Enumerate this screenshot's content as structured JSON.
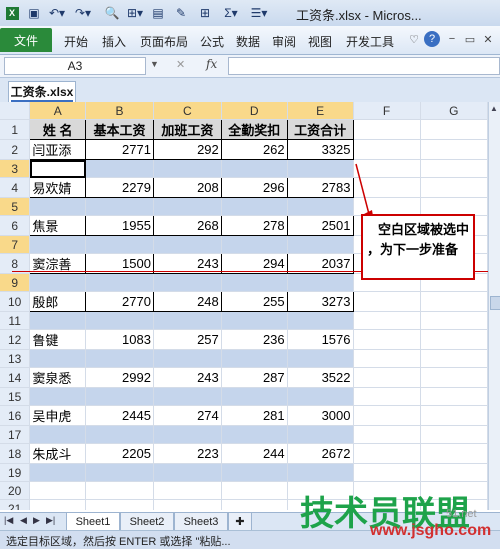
{
  "window": {
    "title": "工资条.xlsx - Micros..."
  },
  "qat": {
    "icons": [
      "save-icon",
      "undo-icon",
      "redo-icon",
      "print-preview-icon",
      "format-icon",
      "paste-icon",
      "format-painter-icon",
      "borders-icon",
      "autosum-icon",
      "align-icon"
    ]
  },
  "ribbon": {
    "file": "文件",
    "tabs": [
      "开始",
      "插入",
      "页面布局",
      "公式",
      "数据",
      "审阅",
      "视图",
      "开发工具"
    ]
  },
  "formula_bar": {
    "name_box": "A3",
    "fx": "fx",
    "formula": ""
  },
  "workbook": {
    "tab": "工资条.xlsx"
  },
  "columns": [
    "A",
    "B",
    "C",
    "D",
    "E",
    "F",
    "G"
  ],
  "headers": [
    "姓 名",
    "基本工资",
    "加班工资",
    "全勤奖扣",
    "工资合计"
  ],
  "rows": [
    {
      "n": "1"
    },
    {
      "n": "2",
      "name": "闫亚添",
      "v": [
        "2771",
        "292",
        "262",
        "3325"
      ]
    },
    {
      "n": "3"
    },
    {
      "n": "4",
      "name": "易欢婧",
      "v": [
        "2279",
        "208",
        "296",
        "2783"
      ]
    },
    {
      "n": "5"
    },
    {
      "n": "6",
      "name": "焦景",
      "v": [
        "1955",
        "268",
        "278",
        "2501"
      ]
    },
    {
      "n": "7"
    },
    {
      "n": "8",
      "name": "窦淙善",
      "v": [
        "1500",
        "243",
        "294",
        "2037"
      ]
    },
    {
      "n": "9"
    },
    {
      "n": "10",
      "name": "殷郎",
      "v": [
        "2770",
        "248",
        "255",
        "3273"
      ]
    },
    {
      "n": "11"
    },
    {
      "n": "12",
      "name": "鲁键",
      "v": [
        "1083",
        "257",
        "236",
        "1576"
      ]
    },
    {
      "n": "13"
    },
    {
      "n": "14",
      "name": "窦泉悉",
      "v": [
        "2992",
        "243",
        "287",
        "3522"
      ]
    },
    {
      "n": "15"
    },
    {
      "n": "16",
      "name": "吴申虎",
      "v": [
        "2445",
        "274",
        "281",
        "3000"
      ]
    },
    {
      "n": "17"
    },
    {
      "n": "18",
      "name": "朱成斗",
      "v": [
        "2205",
        "223",
        "244",
        "2672"
      ]
    },
    {
      "n": "19"
    },
    {
      "n": "20"
    },
    {
      "n": "21"
    },
    {
      "n": "22"
    },
    {
      "n": "23"
    }
  ],
  "callout": {
    "line1": "空白区域被选中",
    "line2": "，为下一步准备"
  },
  "sheets": [
    "Sheet1",
    "Sheet2",
    "Sheet3"
  ],
  "status": {
    "text": "选定目标区域，然后按 ENTER 或选择 \"粘贴..."
  },
  "watermark": {
    "main": "技术员联盟",
    "sub": "www.jsgho.com",
    "side": "51.net"
  }
}
